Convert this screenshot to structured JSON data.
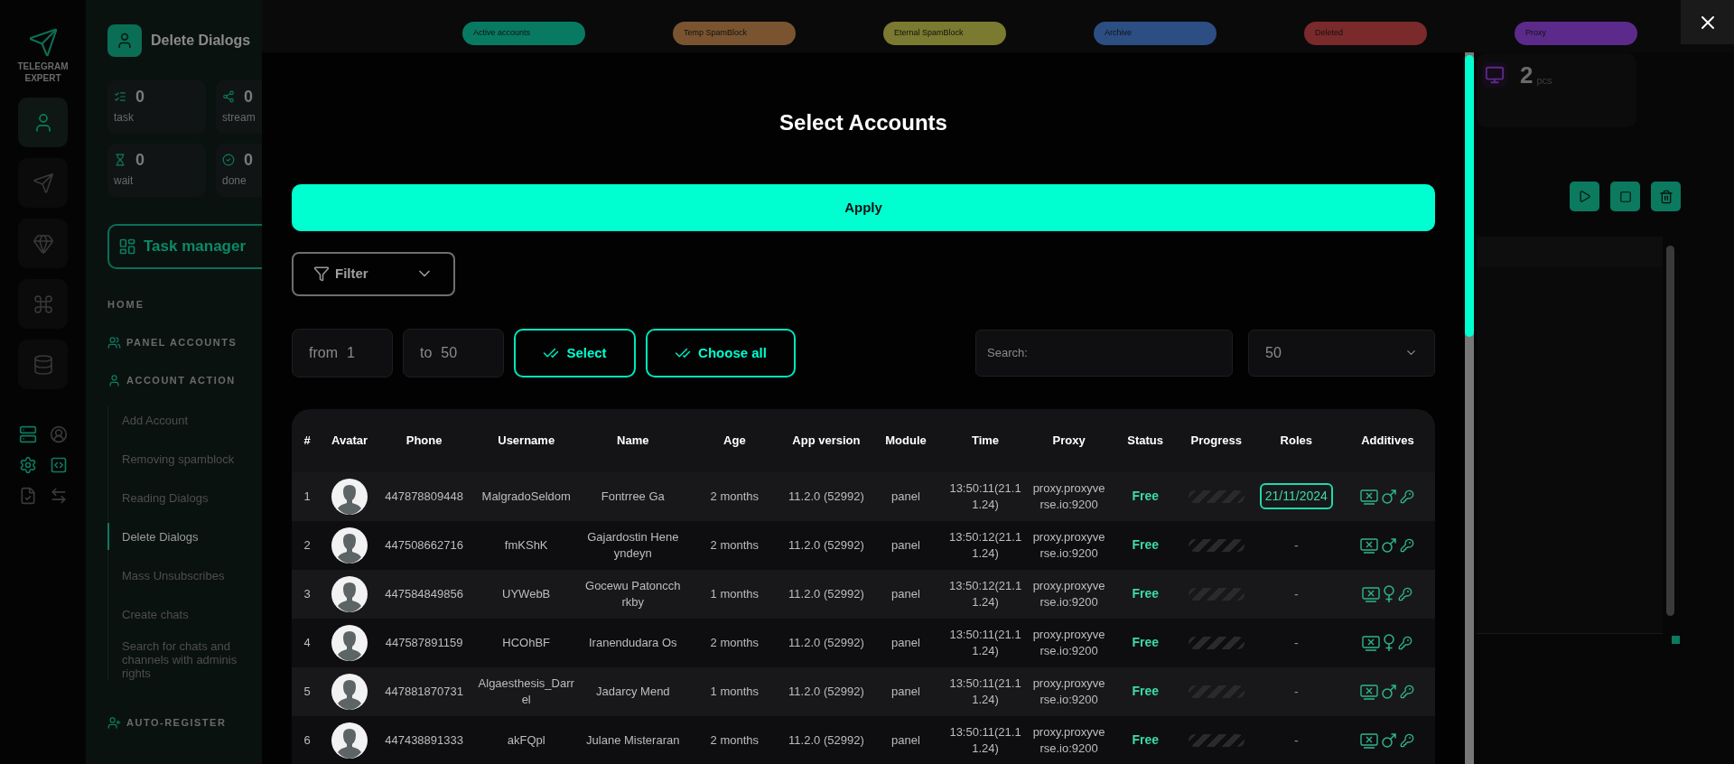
{
  "rail": {
    "logo_text": "TELEGRAM EXPERT",
    "items": [
      {
        "selected": true
      },
      {
        "selected": false
      },
      {
        "selected": false
      },
      {
        "selected": false
      },
      {
        "selected": false
      }
    ]
  },
  "sidebar": {
    "title": "Delete Dialogs",
    "stats": [
      {
        "value": "0",
        "label": "task"
      },
      {
        "value": "0",
        "label": "stream"
      },
      {
        "value": "0",
        "label": "wait"
      },
      {
        "value": "0",
        "label": "done"
      }
    ],
    "task_manager": "Task manager",
    "nav": [
      {
        "kind": "heading",
        "label": "HOME"
      },
      {
        "kind": "section",
        "label": "PANEL ACCOUNTS"
      },
      {
        "kind": "section",
        "label": "ACCOUNT ACTION",
        "children": [
          {
            "label": "Add Account",
            "selected": false
          },
          {
            "label": "Removing spamblock",
            "selected": false
          },
          {
            "label": "Reading Dialogs",
            "selected": false
          },
          {
            "label": "Delete Dialogs",
            "selected": true
          },
          {
            "label": "Mass Unsubscribes",
            "selected": false
          },
          {
            "label": "Create chats",
            "selected": false
          },
          {
            "label": "Search for chats and channels with adminis rights",
            "selected": false
          }
        ]
      },
      {
        "kind": "section",
        "label": "AUTO-REGISTER"
      }
    ]
  },
  "top_bar": {
    "badges": [
      {
        "label": "Active accounts",
        "color": "#087a62"
      },
      {
        "label": "Temp SpamBlock",
        "color": "#7a5430"
      },
      {
        "label": "Eternal SpamBlock",
        "color": "#7a7a30"
      },
      {
        "label": "Archive",
        "color": "#2c4e82"
      },
      {
        "label": "Deleted",
        "color": "#7a2a2a"
      },
      {
        "label": "Proxy",
        "color": "#5c2a8a"
      }
    ]
  },
  "modal": {
    "title": "Select Accounts",
    "apply": "Apply",
    "filter": "Filter",
    "range_from": {
      "label": "from",
      "value": "1"
    },
    "range_to": {
      "label": "to",
      "value": "50"
    },
    "select": "Select",
    "choose_all": "Choose all",
    "search": {
      "placeholder": "Search:"
    },
    "page_size": "50",
    "table": {
      "columns": [
        "#",
        "Avatar",
        "Phone",
        "Username",
        "Name",
        "Age",
        "App version",
        "Module",
        "Time",
        "Proxy",
        "Status",
        "Progress",
        "Roles",
        "Additives"
      ],
      "rows": [
        {
          "num": "1",
          "phone": "447878809448",
          "username": "MalgradoSeldom",
          "name": "Fontrree Ga",
          "age": "2 months",
          "app_version": "11.2.0 (52992)",
          "module": "panel",
          "time": "13:50:11(21.11.24)",
          "proxy": "proxy.proxyverse.io:9200",
          "status": "Free",
          "role": {
            "kind": "date",
            "text": "21/11/2024"
          },
          "female": false
        },
        {
          "num": "2",
          "phone": "447508662716",
          "username": "fmKShK",
          "name": "Gajardostin Heneyndeyn",
          "age": "2 months",
          "app_version": "11.2.0 (52992)",
          "module": "panel",
          "time": "13:50:12(21.11.24)",
          "proxy": "proxy.proxyverse.io:9200",
          "status": "Free",
          "role": {
            "kind": "empty",
            "text": "-"
          },
          "female": false
        },
        {
          "num": "3",
          "phone": "447584849856",
          "username": "UYWebB",
          "name": "Gocewu Patoncchrkby",
          "age": "1 months",
          "app_version": "11.2.0 (52992)",
          "module": "panel",
          "time": "13:50:12(21.11.24)",
          "proxy": "proxy.proxyverse.io:9200",
          "status": "Free",
          "role": {
            "kind": "empty",
            "text": "-"
          },
          "female": true
        },
        {
          "num": "4",
          "phone": "447587891159",
          "username": "HCOhBF",
          "name": "Iranendudara Os",
          "age": "2 months",
          "app_version": "11.2.0 (52992)",
          "module": "panel",
          "time": "13:50:11(21.11.24)",
          "proxy": "proxy.proxyverse.io:9200",
          "status": "Free",
          "role": {
            "kind": "empty",
            "text": "-"
          },
          "female": true
        },
        {
          "num": "5",
          "phone": "447881870731",
          "username": "Algaesthesis_Darrel",
          "name": "Jadarcy Mend",
          "age": "1 months",
          "app_version": "11.2.0 (52992)",
          "module": "panel",
          "time": "13:50:11(21.11.24)",
          "proxy": "proxy.proxyverse.io:9200",
          "status": "Free",
          "role": {
            "kind": "empty",
            "text": "-"
          },
          "female": false
        },
        {
          "num": "6",
          "phone": "447438891333",
          "username": "akFQpl",
          "name": "Julane Misteraran",
          "age": "2 months",
          "app_version": "11.2.0 (52992)",
          "module": "panel",
          "time": "13:50:11(21.11.24)",
          "proxy": "proxy.proxyverse.io:9200",
          "status": "Free",
          "role": {
            "kind": "empty",
            "text": "-"
          },
          "female": false
        }
      ]
    }
  },
  "right_panel": {
    "stat": {
      "value": "2",
      "unit": "pcs"
    }
  }
}
